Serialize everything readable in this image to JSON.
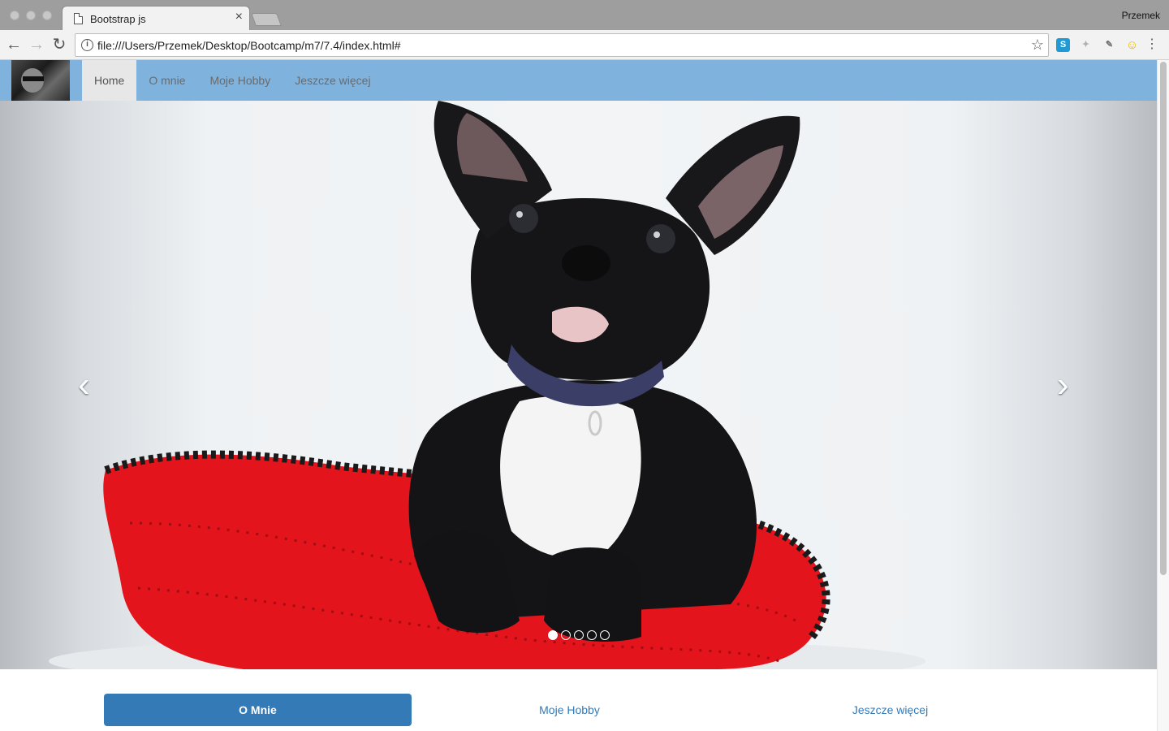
{
  "browser": {
    "tab_title": "Bootstrap js",
    "tab_close": "×",
    "profile_name": "Przemek",
    "url": "file:///Users/Przemek/Desktop/Bootcamp/m7/7.4/index.html#",
    "back_glyph": "←",
    "forward_glyph": "→",
    "reload_glyph": "↻",
    "info_glyph": "i",
    "star_glyph": "☆",
    "menu_glyph": "⋮",
    "extensions": [
      {
        "icon": "skype-icon",
        "glyph": "S",
        "color": "#1e9bd7"
      },
      {
        "icon": "puzzle-icon",
        "glyph": "✦",
        "color": "#b0b0b0"
      },
      {
        "icon": "tool-icon",
        "glyph": "✎",
        "color": "#707070"
      },
      {
        "icon": "smiley-icon",
        "glyph": "☺",
        "color": "#e6b800"
      }
    ]
  },
  "navbar": {
    "brand_alt": "logo",
    "links": [
      {
        "label": "Home",
        "active": true
      },
      {
        "label": "O mnie",
        "active": false
      },
      {
        "label": "Moje Hobby",
        "active": false
      },
      {
        "label": "Jeszcze więcej",
        "active": false
      }
    ]
  },
  "carousel": {
    "prev_glyph": "‹",
    "next_glyph": "›",
    "slide_count": 5,
    "active_slide": 1,
    "image_subject": "french-bulldog-on-red-pillow"
  },
  "pills": [
    {
      "label": "O Mnie",
      "active": true
    },
    {
      "label": "Moje Hobby",
      "active": false
    },
    {
      "label": "Jeszcze więcej",
      "active": false
    }
  ],
  "colors": {
    "navbar_bg": "#7fb2dc",
    "pill_active": "#337ab7",
    "pillow_red": "#e3141c"
  }
}
